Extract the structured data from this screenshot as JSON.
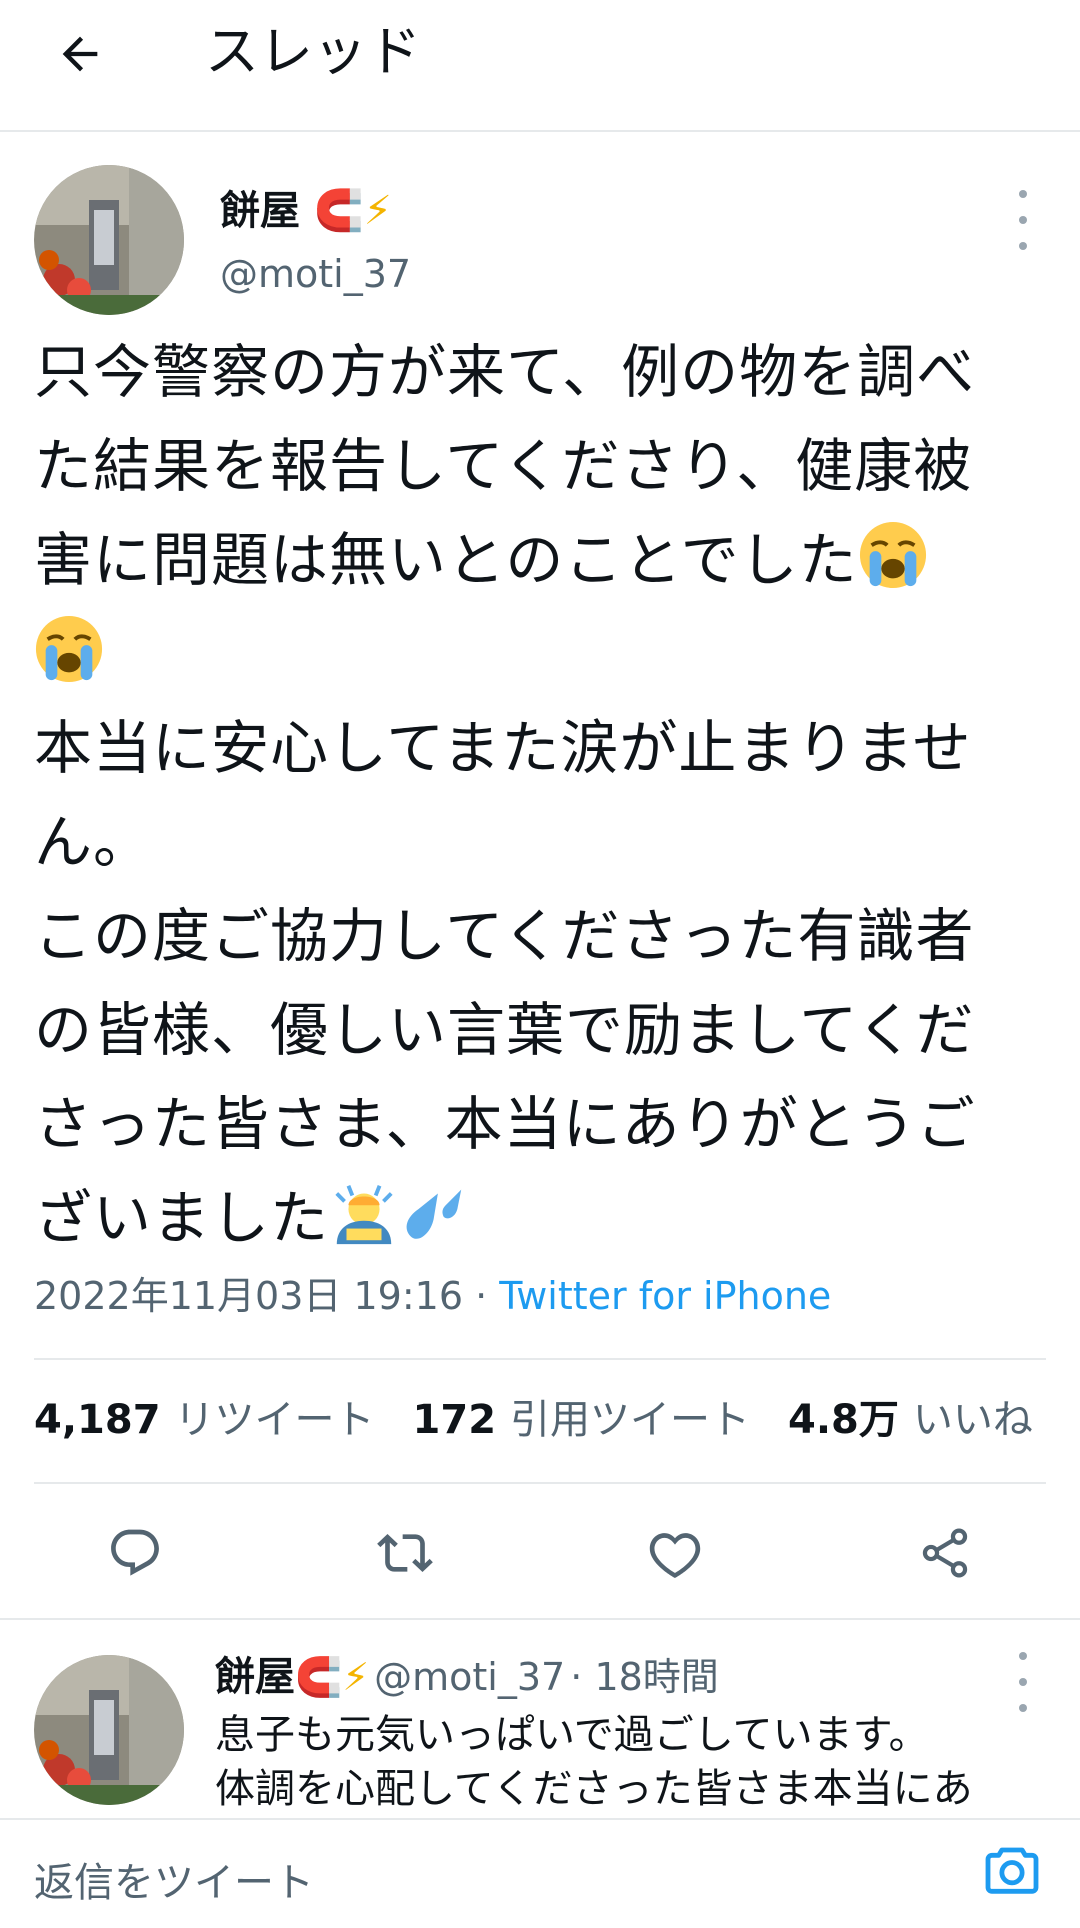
{
  "header": {
    "title": "スレッド"
  },
  "tweet": {
    "author_name": "餅屋",
    "author_handle": "@moti_37",
    "lines": [
      "只今警察の方が来て、例の物を調べ",
      "た結果を報告してくださり、健康被",
      "害に問題は無いとのことでした",
      "",
      "本当に安心してまた涙が止まりませ",
      "ん。",
      "この度ご協力してくださった有識者",
      "の皆様、優しい言葉で励ましてくだ",
      "さった皆さま、本当にありがとうご",
      "ざいました"
    ],
    "timestamp": "2022年11月03日 19:16",
    "separator": " · ",
    "source": "Twitter for iPhone",
    "stats": {
      "retweets_count": "4,187",
      "retweets_label": "リツイート",
      "quotes_count": "172",
      "quotes_label": "引用ツイート",
      "likes_count": "4.8万",
      "likes_label": "いいね"
    }
  },
  "reply": {
    "author_name": "餅屋",
    "author_handle": "@moti_37",
    "time": "· 18時間",
    "lines": [
      "息子も元気いっぱいで過ごしています。",
      "体調を心配してくださった皆さま本当にあ"
    ]
  },
  "compose": {
    "placeholder": "返信をツイート"
  },
  "colors": {
    "accent": "#1d9bf0",
    "secondary_text": "#536471",
    "divider": "#e6e9eb"
  },
  "icons": [
    "back-arrow-icon",
    "magnet-icon",
    "lightning-icon",
    "more-icon",
    "crying-face-icon",
    "person-bowing-icon",
    "sweat-droplets-icon",
    "reply-icon",
    "retweet-icon",
    "like-icon",
    "share-icon",
    "camera-icon"
  ]
}
